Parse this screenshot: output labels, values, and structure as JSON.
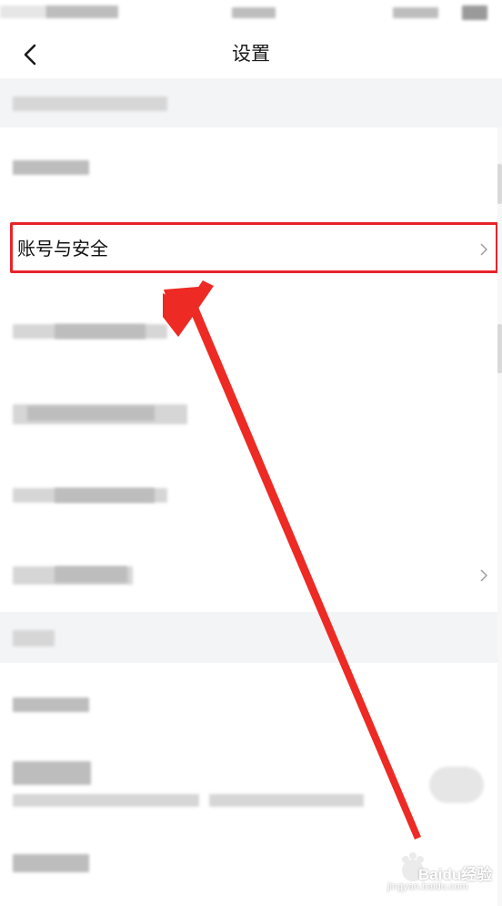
{
  "header": {
    "title": "设置"
  },
  "highlighted_item": {
    "label": "账号与安全"
  },
  "watermark": {
    "brand": "Baidu经验",
    "url": "jingyan.baidu.com"
  },
  "colors": {
    "highlight": "#e8242a",
    "arrow": "#ee2a24",
    "section_bg": "#f3f4f6"
  },
  "icons": {
    "back": "chevron-left-icon",
    "row_chevron": "chevron-right-icon"
  }
}
